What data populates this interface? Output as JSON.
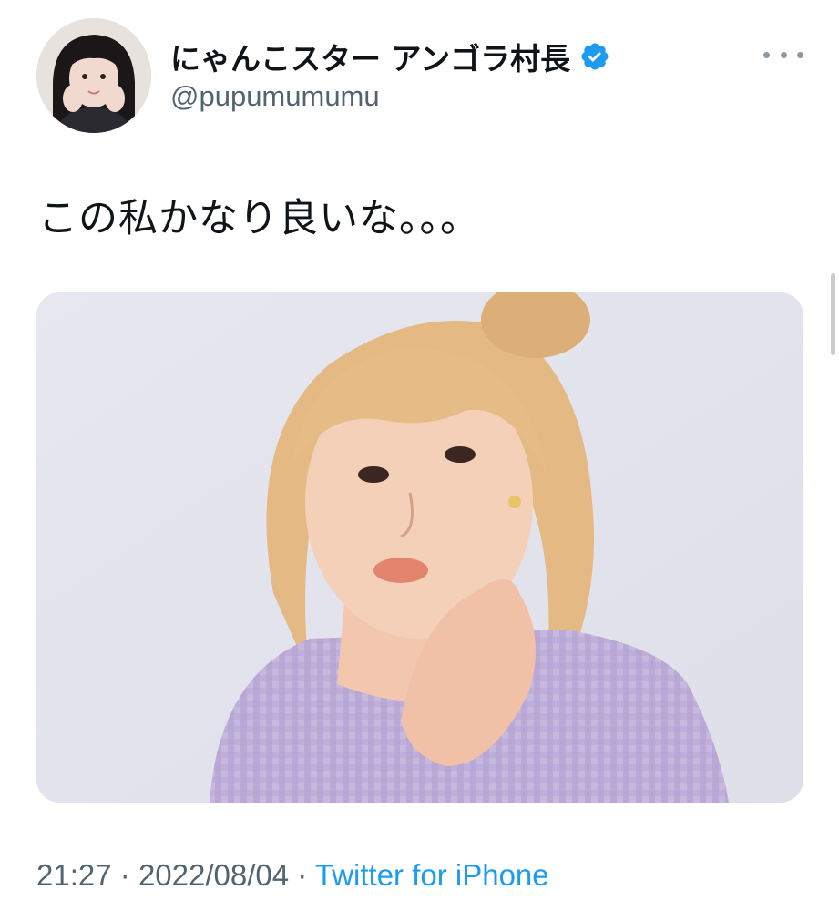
{
  "tweet": {
    "author": {
      "display_name": "にゃんこスター アンゴラ村長",
      "handle": "@pupumumumu",
      "verified": true
    },
    "text": "この私かなり良いな。。。",
    "media": {
      "type": "photo",
      "alt": ""
    },
    "time": "21:27",
    "date": "2022/08/04",
    "separator": "·",
    "source": "Twitter for iPhone"
  },
  "colors": {
    "verified_badge": "#1d9bf0",
    "link": "#1d9bf0",
    "secondary_text": "#536471"
  },
  "icons": {
    "verified": "verified-badge-icon",
    "more": "more-options-icon"
  }
}
